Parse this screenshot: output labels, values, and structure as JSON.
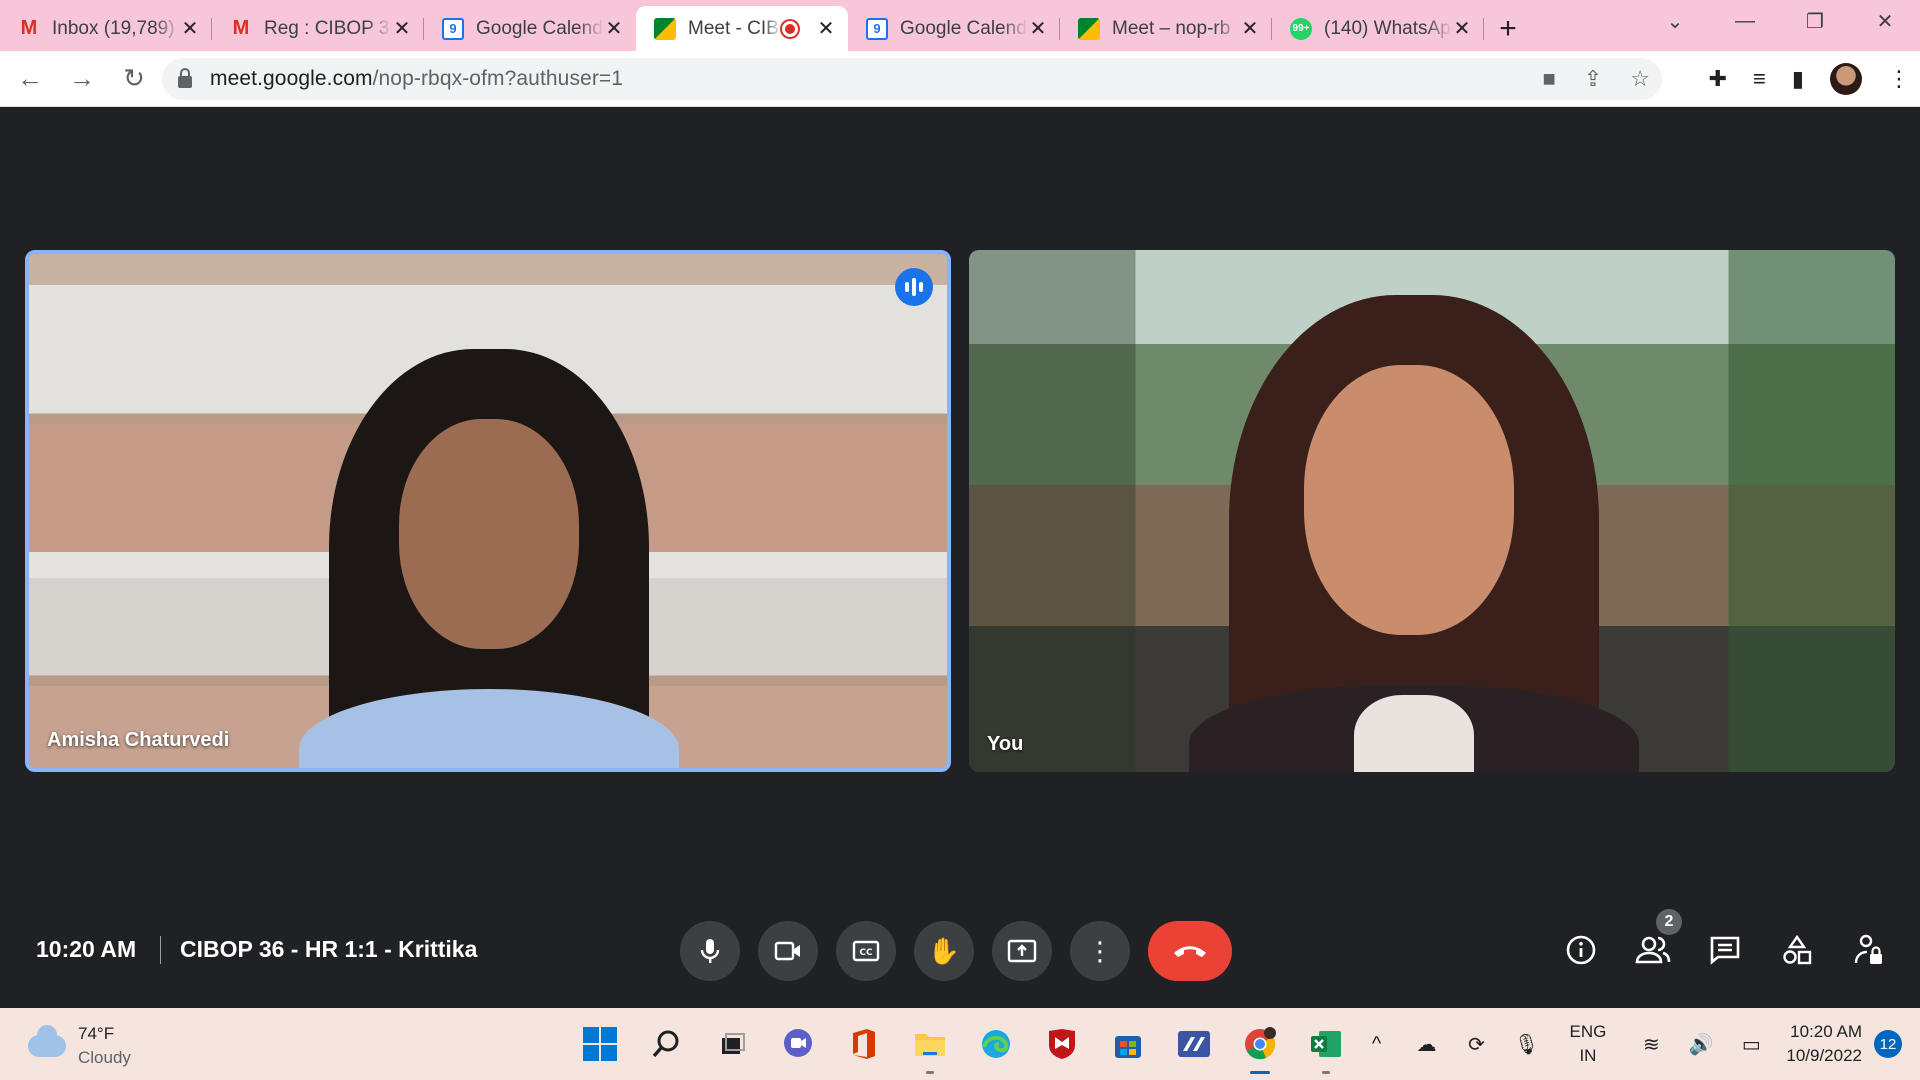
{
  "browser": {
    "tabs": [
      {
        "title": "Inbox (19,789)",
        "favicon": "gmail-icon"
      },
      {
        "title": "Reg : CIBOP 36",
        "favicon": "gmail-icon"
      },
      {
        "title": "Google Calend",
        "favicon": "calendar-icon",
        "favicon_text": "9"
      },
      {
        "title": "Meet - CIB",
        "favicon": "meet-icon",
        "recording": true
      },
      {
        "title": "Google Calend",
        "favicon": "calendar-icon",
        "favicon_text": "9"
      },
      {
        "title": "Meet – nop-rb",
        "favicon": "meet-icon"
      },
      {
        "title": "(140) WhatsAp",
        "favicon": "whatsapp-icon",
        "favicon_text": "99+"
      }
    ],
    "new_tab": "+",
    "url_host": "meet.google.com",
    "url_path": "/nop-rbqx-ofm?authuser=1"
  },
  "meet": {
    "participants": [
      {
        "name": "Amisha Chaturvedi",
        "speaking": true
      },
      {
        "name": "You",
        "speaking": false
      }
    ],
    "time": "10:20 AM",
    "meeting_title": "CIBOP 36 - HR 1:1 - Krittika",
    "people_count": "2"
  },
  "taskbar": {
    "weather_temp": "74°F",
    "weather_condition": "Cloudy",
    "language_line1": "ENG",
    "language_line2": "IN",
    "clock_time": "10:20 AM",
    "clock_date": "10/9/2022",
    "notifications": "12"
  },
  "colors": {
    "tab_strip": "#f7c6d9",
    "meet_background": "#202124",
    "speaking_border": "#8ab4f8",
    "end_call": "#ea4335",
    "taskbar": "#f6e4df"
  }
}
